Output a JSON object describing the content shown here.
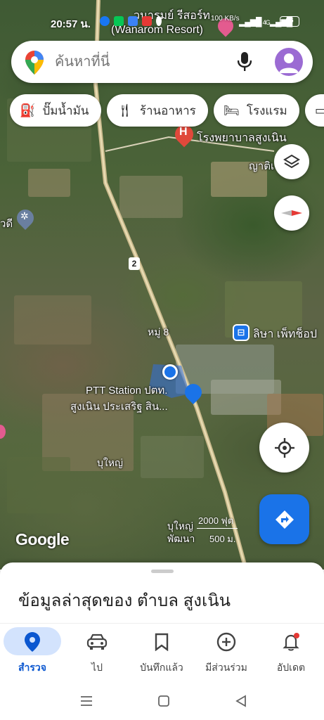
{
  "status_bar": {
    "time": "20:57 น.",
    "net_speed": "100 KB/s",
    "signal": "4G",
    "battery": "66"
  },
  "search": {
    "placeholder": "ค้นหาที่นี่"
  },
  "chips": [
    {
      "icon": "gas-station-icon",
      "label": "ปั๊มน้ำมัน"
    },
    {
      "icon": "restaurant-icon",
      "label": "ร้านอาหาร"
    },
    {
      "icon": "hotel-icon",
      "label": "โรงแรม"
    }
  ],
  "map_labels": {
    "resort_th": "วนารมย์ รีสอร์ท",
    "resort_en": "(Wanarom Resort)",
    "hospital": "โรงพยาบาลสูงเนิน",
    "partial_right": "ญาติเ",
    "partial_left": "วดี",
    "route_number": "2",
    "village_8": "หมู่ 8",
    "shop": "ลิษา เพ็ทช็อป",
    "station_line1": "PTT Station ปตท.",
    "station_line2": "สูงเนิน ประเสริฐ สิน...",
    "bu_yai": "บุใหญ่",
    "bu_yai_2": "บุใหญ่",
    "phattana": "พัฒนา"
  },
  "scale": {
    "feet": "2000 ฟุต",
    "meters": "500 ม."
  },
  "google_logo": "Google",
  "sheet": {
    "title": "ข้อมูลล่าสุดของ ตำบล สูงเนิน"
  },
  "bottom_nav": [
    {
      "icon": "explore-pin-icon",
      "label": "สำรวจ",
      "active": true
    },
    {
      "icon": "car-icon",
      "label": "ไป",
      "active": false
    },
    {
      "icon": "bookmark-icon",
      "label": "บันทึกแล้ว",
      "active": false
    },
    {
      "icon": "add-circle-icon",
      "label": "มีส่วนร่วม",
      "active": false
    },
    {
      "icon": "bell-icon",
      "label": "อัปเดต",
      "active": false
    }
  ],
  "colors": {
    "accent": "#1a73e8",
    "active_pill": "#d3e3fd",
    "active_text": "#0b57d0",
    "hospital": "#e0483b",
    "shop": "#1a73e8"
  }
}
